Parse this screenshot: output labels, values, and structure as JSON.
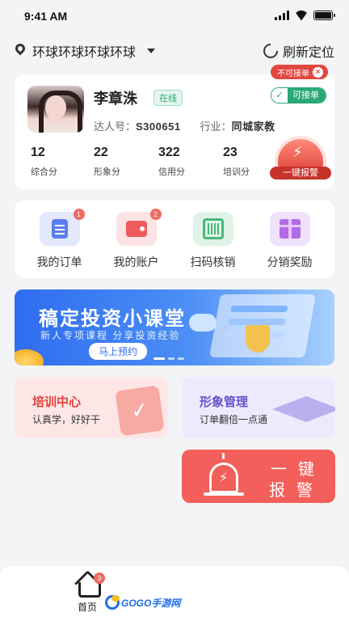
{
  "status_bar": {
    "time": "9:41 AM"
  },
  "location": {
    "name": "环球环球环球环球",
    "refresh_label": "刷新定位"
  },
  "profile": {
    "name": "李章洙",
    "online_label": "在线",
    "not_accept_label": "不可接单",
    "accept_label": "可接单",
    "id_label": "达人号：",
    "id_value": "S300651",
    "industry_label": "行业：",
    "industry_value": "同城家教",
    "stats": [
      {
        "value": "12",
        "label": "综合分"
      },
      {
        "value": "22",
        "label": "形象分"
      },
      {
        "value": "322",
        "label": "信用分"
      },
      {
        "value": "23",
        "label": "培训分"
      }
    ],
    "alarm_label": "一键报警"
  },
  "menu": [
    {
      "label": "我的订单",
      "badge": "1",
      "icon": "order-icon",
      "bg": "#e3e8fb"
    },
    {
      "label": "我的账户",
      "badge": "2",
      "icon": "wallet-icon",
      "bg": "#fde3e3"
    },
    {
      "label": "扫码核销",
      "badge": "",
      "icon": "scan-icon",
      "bg": "#e0f3e7"
    },
    {
      "label": "分销奖励",
      "badge": "",
      "icon": "gift-icon",
      "bg": "#efe2fb"
    }
  ],
  "banner": {
    "title": "稿定投资小课堂",
    "subtitle": "新人专项课程  分享投资经验",
    "button": "马上预约"
  },
  "tiles": {
    "training": {
      "title": "培训中心",
      "subtitle": "认真学，好好干"
    },
    "image": {
      "title": "形象管理",
      "subtitle": "订单翻倍一点通"
    }
  },
  "big_alarm": {
    "line1": "一键",
    "line2": "报警"
  },
  "tabbar": {
    "home_label": "首页",
    "home_badge": "3"
  },
  "watermark": "GOGO手游网"
}
